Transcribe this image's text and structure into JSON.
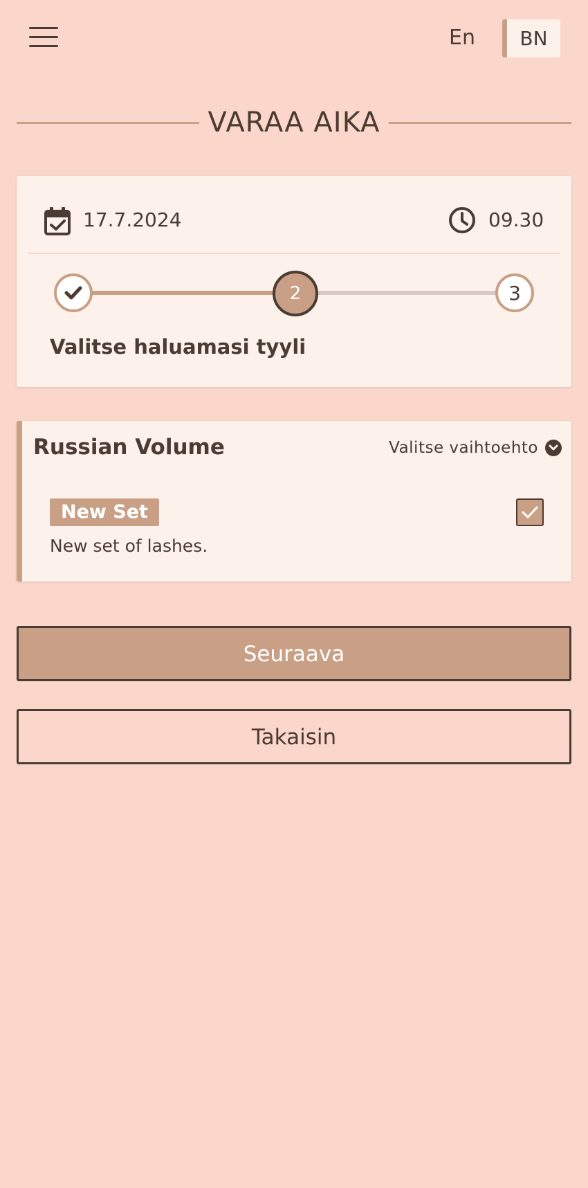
{
  "header": {
    "menu_icon": "hamburger-menu-icon",
    "lang_en": "En",
    "lang_bn": "BN"
  },
  "page": {
    "title": "VARAA AIKA"
  },
  "booking": {
    "date": "17.7.2024",
    "time": "09.30",
    "date_icon": "calendar-check-icon",
    "time_icon": "clock-icon"
  },
  "stepper": {
    "current_step": 2,
    "steps": [
      {
        "label": "",
        "state": "done"
      },
      {
        "label": "2",
        "state": "active"
      },
      {
        "label": "3",
        "state": "pending"
      }
    ],
    "caption": "Valitse haluamasi tyyli"
  },
  "service": {
    "name": "Russian Volume",
    "select_label": "Valitse vaihtoehto",
    "options": [
      {
        "badge": "New Set",
        "description": "New set of lashes.",
        "checked": true
      }
    ]
  },
  "actions": {
    "next_label": "Seuraava",
    "back_label": "Takaisin"
  },
  "colors": {
    "background": "#fad7ca",
    "accent": "#c9a086",
    "text": "#4a3b33",
    "card": "#fdf1ec"
  }
}
